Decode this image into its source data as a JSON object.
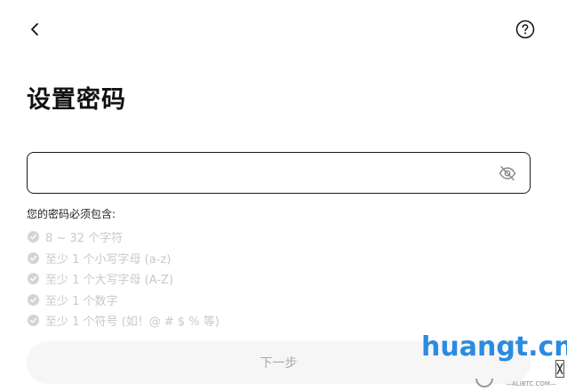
{
  "header": {
    "back_icon": "chevron-left-icon",
    "help_icon": "question-circle-icon"
  },
  "page_title": "设置密码",
  "password_field": {
    "value": "",
    "placeholder": "",
    "toggle_icon": "eye-off-icon"
  },
  "requirements": {
    "heading": "您的密码必须包含:",
    "items": [
      {
        "label": "8 ~ 32 个字符",
        "met": false
      },
      {
        "label": "至少 1 个小写字母 (a-z)",
        "met": false
      },
      {
        "label": "至少 1 个大写字母 (A-Z)",
        "met": false
      },
      {
        "label": "至少 1 个数字",
        "met": false
      },
      {
        "label": "至少 1 个符号 (如！@ # $ % 等)",
        "met": false
      }
    ]
  },
  "next_button": {
    "label": "下一步",
    "enabled": false
  },
  "watermark": {
    "text": "huangt.cn",
    "sub": "—ALIBTC.COM—"
  },
  "colors": {
    "text_primary": "#111111",
    "border": "#1b1b1b",
    "requirement_inactive": "#c9c9c9",
    "button_disabled_bg": "#f6f6f6",
    "button_disabled_text": "#a9a9a9",
    "watermark": "#2a8be0"
  }
}
